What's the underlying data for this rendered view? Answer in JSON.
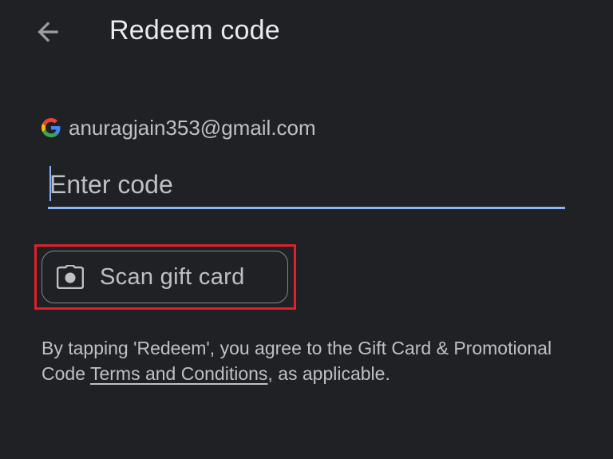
{
  "header": {
    "title": "Redeem code",
    "back_icon": "arrow-back-icon"
  },
  "account": {
    "email": "anuragjain353@gmail.com",
    "icon": "google-g-icon"
  },
  "code_input": {
    "placeholder": "Enter code",
    "value": "",
    "accent_color": "#8ab4f8"
  },
  "scan_button": {
    "label": "Scan gift card",
    "icon": "camera-icon",
    "highlight_color": "#e0202a"
  },
  "legal": {
    "prefix": "By tapping 'Redeem', you agree to the Gift Card & Promotional Code ",
    "link_text": "Terms and Conditions",
    "suffix": ", as applicable."
  },
  "colors": {
    "background": "#202124",
    "text_primary": "#e8eaed",
    "text_secondary": "#bdc1c6"
  }
}
